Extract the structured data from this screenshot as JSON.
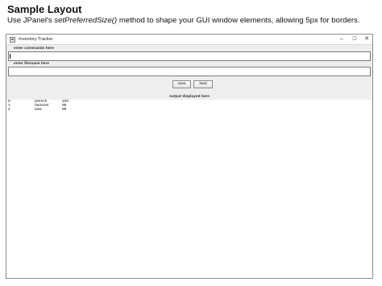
{
  "document": {
    "heading": "Sample Layout",
    "subtitle_prefix": "Use JPanel's ",
    "subtitle_method": "setPreferredSize()",
    "subtitle_suffix": " method to shape your GUI window elements, allowing 5px for borders."
  },
  "window": {
    "title": "Inventory Tracker",
    "controls": {
      "minimize": "–",
      "maximize": "☐",
      "close": "✕"
    }
  },
  "form": {
    "commands_label": "enter commands here",
    "commands_value": "",
    "filename_label": "enter filename here",
    "filename_value": "",
    "save_label": "save",
    "load_label": "load"
  },
  "output": {
    "label": "output displayed here",
    "rows": [
      {
        "id": "0",
        "name": "wrench",
        "qty": "100"
      },
      {
        "id": "1",
        "name": "hammer",
        "qty": "99"
      },
      {
        "id": "2",
        "name": "saw",
        "qty": "88"
      }
    ]
  },
  "icons": {
    "app": "java-window-icon",
    "minimize": "minimize-icon",
    "maximize": "maximize-icon",
    "close": "close-icon"
  }
}
